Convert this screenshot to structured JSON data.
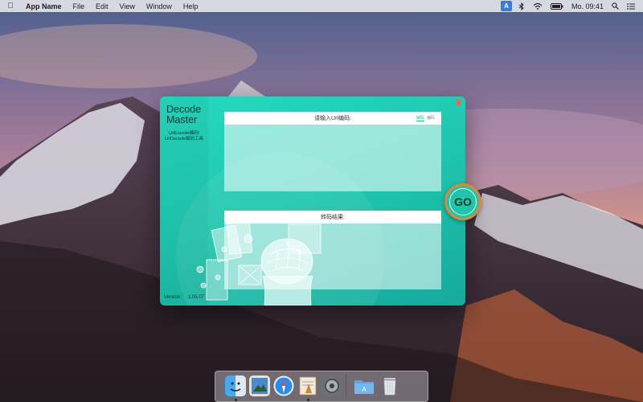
{
  "menubar": {
    "app_name": "App Name",
    "menus": [
      "File",
      "Edit",
      "View",
      "Window",
      "Help"
    ],
    "input_badge": "A",
    "clock": "Mo. 09:41"
  },
  "app": {
    "brand_line1": "Decode",
    "brand_line2": "Master",
    "subtitle_line1": "UrlEncode编码/",
    "subtitle_line2": "UrlDecode解码工具",
    "input_panel": {
      "label": "请输入Url编码:",
      "toggle_decode": "解码",
      "toggle_encode": "编码"
    },
    "output_panel": {
      "label": "转码结果:"
    },
    "go_label": "GO",
    "version_label": "Version :",
    "version_value": "1.05.07"
  },
  "dock": {
    "items": [
      "finder-icon",
      "preview-icon",
      "safari-icon",
      "script-editor-icon",
      "system-preferences-icon",
      "applications-folder-icon",
      "trash-icon"
    ]
  },
  "colors": {
    "app_accent": "#27d9bf",
    "go_border": "#d9893a",
    "close_button": "#ff5f57"
  }
}
